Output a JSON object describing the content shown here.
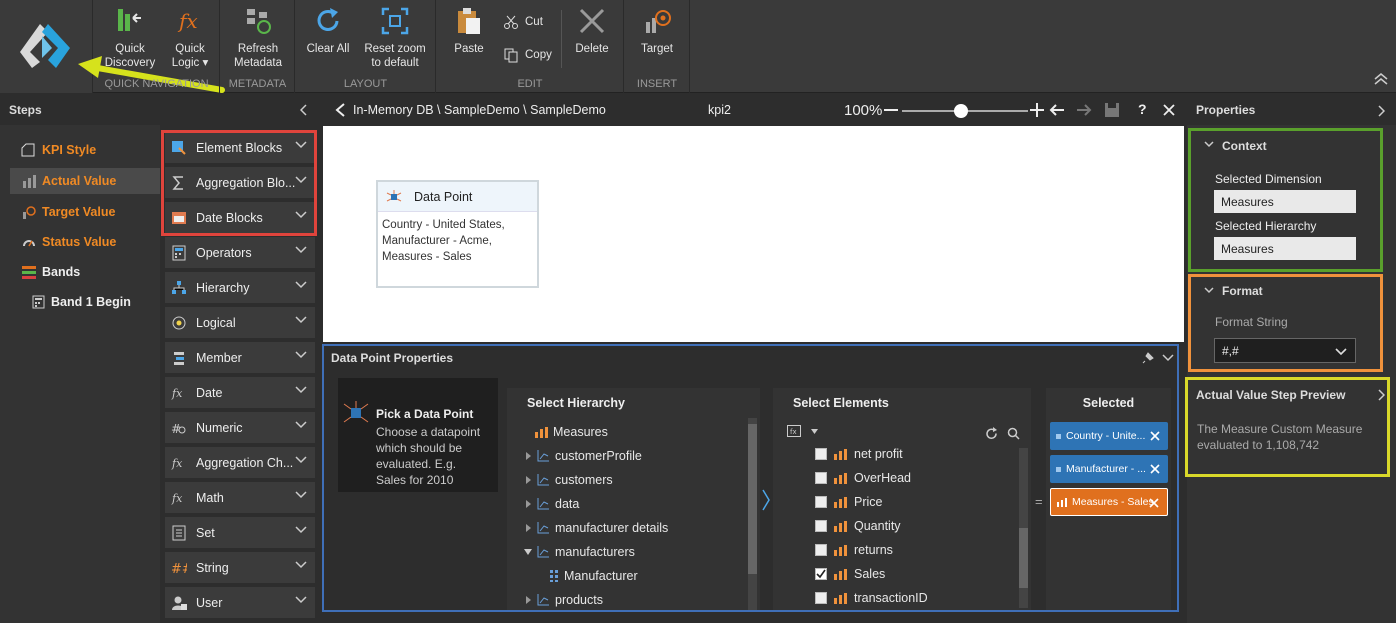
{
  "ribbon": {
    "groups": [
      {
        "label": "QUICK NAVIGATION"
      },
      {
        "label": "METADATA"
      },
      {
        "label": "LAYOUT"
      },
      {
        "label": "EDIT"
      },
      {
        "label": "INSERT"
      }
    ],
    "buttons": {
      "quick_discovery": "Quick\nDiscovery",
      "quick_logic": "Quick\nLogic ▾",
      "refresh_metadata": "Refresh\nMetadata",
      "clear_all": "Clear All",
      "reset_zoom": "Reset zoom\nto default",
      "paste": "Paste",
      "cut": "Cut",
      "copy": "Copy",
      "delete": "Delete",
      "target": "Target"
    }
  },
  "steps": {
    "title": "Steps",
    "items": [
      {
        "label": "KPI Style"
      },
      {
        "label": "Actual Value"
      },
      {
        "label": "Target Value"
      },
      {
        "label": "Status Value"
      },
      {
        "label": "Bands"
      },
      {
        "label": "Band 1 Begin"
      }
    ]
  },
  "blocks": [
    {
      "label": "Element Blocks",
      "icon": "element-blocks-icon"
    },
    {
      "label": "Aggregation Blo...",
      "icon": "sigma-icon"
    },
    {
      "label": "Date Blocks",
      "icon": "calendar-icon"
    },
    {
      "label": "Operators",
      "icon": "calculator-icon"
    },
    {
      "label": "Hierarchy",
      "icon": "hierarchy-icon"
    },
    {
      "label": "Logical",
      "icon": "logical-icon"
    },
    {
      "label": "Member",
      "icon": "member-icon"
    },
    {
      "label": "Date",
      "icon": "fx-date-icon"
    },
    {
      "label": "Numeric",
      "icon": "numeric-icon"
    },
    {
      "label": "Aggregation Ch...",
      "icon": "fx-aggregation-icon"
    },
    {
      "label": "Math",
      "icon": "fx-math-icon"
    },
    {
      "label": "Set",
      "icon": "set-icon"
    },
    {
      "label": "String",
      "icon": "string-icon"
    },
    {
      "label": "User",
      "icon": "user-icon"
    }
  ],
  "canvas_header": {
    "path": "In-Memory DB \\ SampleDemo \\ SampleDemo",
    "name": "kpi2",
    "zoom": "100%"
  },
  "data_point_card": {
    "title": "Data Point",
    "body": "Country - United States,\nManufacturer - Acme,\nMeasures - Sales"
  },
  "dp_properties": {
    "title": "Data Point Properties",
    "hint_title": "Pick a Data Point",
    "hint_body": "Choose a datapoint\nwhich should be\nevaluated. E.g.\nSales for 2010",
    "hierarchy_head": "Select Hierarchy",
    "hierarchy": [
      {
        "label": "Measures"
      },
      {
        "label": "customerProfile"
      },
      {
        "label": "customers"
      },
      {
        "label": "data"
      },
      {
        "label": "manufacturer details"
      },
      {
        "label": "manufacturers"
      },
      {
        "label": "Manufacturer"
      },
      {
        "label": "products"
      }
    ],
    "elements_head": "Select Elements",
    "elements": [
      {
        "label": "net profit",
        "checked": false
      },
      {
        "label": "OverHead",
        "checked": false
      },
      {
        "label": "Price",
        "checked": false
      },
      {
        "label": "Quantity",
        "checked": false
      },
      {
        "label": "returns",
        "checked": false
      },
      {
        "label": "Sales",
        "checked": true
      },
      {
        "label": "transactionID",
        "checked": false
      }
    ],
    "selected_head": "Selected",
    "selected": [
      {
        "label": "Country - Unite...",
        "color": "#2e74b5"
      },
      {
        "label": "Manufacturer - ...",
        "color": "#2e74b5"
      },
      {
        "label": "Measures - Sales",
        "color": "#e0701e"
      }
    ]
  },
  "properties": {
    "title": "Properties",
    "context_title": "Context",
    "dimension_label": "Selected Dimension",
    "dimension_value": "Measures",
    "hierarchy_label": "Selected Hierarchy",
    "hierarchy_value": "Measures",
    "format_title": "Format",
    "format_label": "Format String",
    "format_value": "#,#",
    "preview_title": "Actual Value Step Preview",
    "preview_body": "The Measure Custom Measure\nevaluated to 1,108,742"
  },
  "colors": {
    "orange": "#f08a24",
    "blue_chip": "#2e74b5",
    "red_outline": "#e0443c",
    "blue_outline": "#3f6fb8",
    "green_outline": "#5aa02c",
    "orange_outline": "#f0923c",
    "yellow_outline": "#d9d82a"
  }
}
